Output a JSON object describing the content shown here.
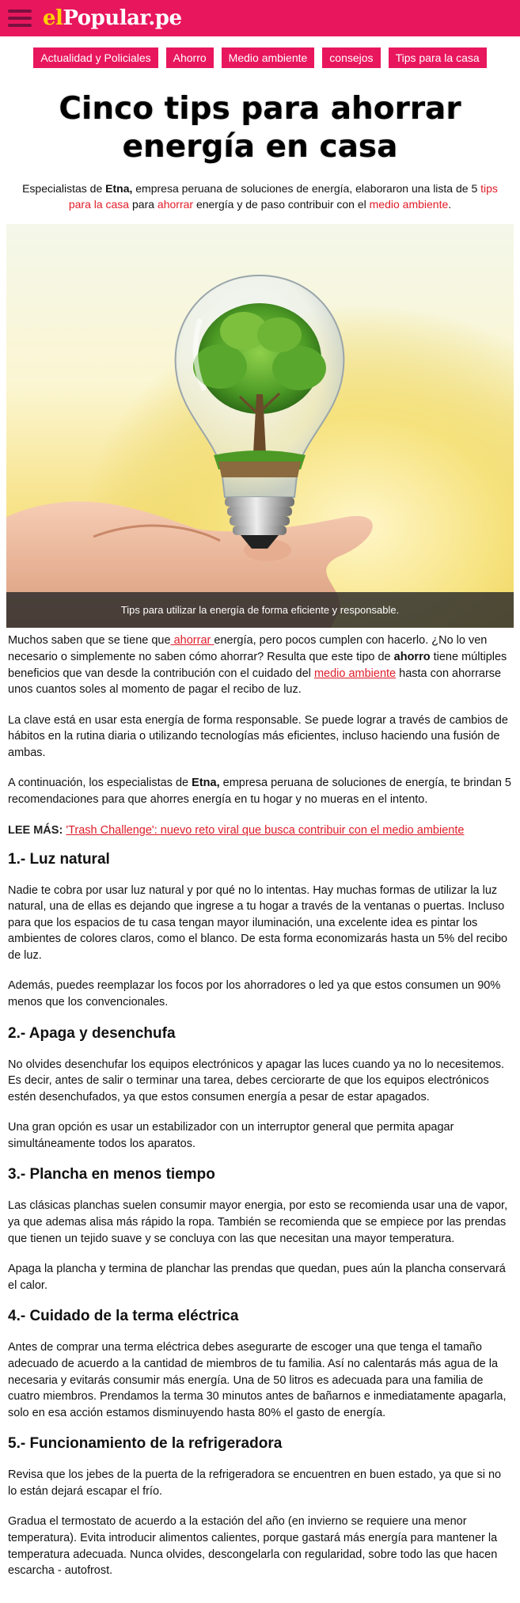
{
  "header": {
    "logo_prefix": "el",
    "logo_main": "Popular",
    "logo_suffix": ".pe",
    "brand_color": "#e8175d"
  },
  "tags": [
    "Actualidad y Policiales",
    "Ahorro",
    "Medio ambiente",
    "consejos",
    "Tips para la casa"
  ],
  "article": {
    "title": "Cinco tips para ahorrar energía en casa",
    "lead": {
      "t1": "Especialistas de ",
      "b1": "Etna,",
      "t2": " empresa peruana de soluciones de energía, elaboraron una lista de 5 ",
      "l1": "tips para la casa",
      "t3": " para ",
      "l2": "ahorrar",
      "t4": " energía y de paso contribuir con el ",
      "l3": "medio ambiente",
      "t5": "."
    },
    "image_caption": "Tips para utilizar la energía de forma eficiente y responsable.",
    "p1": {
      "t1": "Muchos saben que se tiene que",
      "l1": " ahorrar ",
      "t2": "energía, pero pocos cumplen con hacerlo. ¿No lo ven necesario o simplemente no saben cómo ahorrar? Resulta que este tipo de ",
      "b1": "ahorro",
      "t3": " tiene múltiples beneficios que van desde la contribución con el cuidado del ",
      "l2": "medio ambiente",
      "t4": " hasta con ahorrarse unos cuantos soles al momento de pagar el recibo de luz."
    },
    "p2": "La clave está en usar esta energía de forma responsable. Se puede lograr a través de cambios de hábitos en la rutina diaria o utilizando tecnologías más eficientes, incluso haciendo una fusión de ambas.",
    "p3": {
      "t1": "A continuación, los especialistas de ",
      "b1": "Etna,",
      "t2": " empresa peruana de soluciones de energía, te brindan 5 recomendaciones para que ahorres energía en tu hogar  y no mueras en el intento."
    },
    "lee_mas": {
      "label": "LEE MÁS:",
      "link": "'Trash Challenge': nuevo reto viral que busca contribuir con el medio ambiente"
    },
    "sections": [
      {
        "heading": "1.- Luz natural",
        "paras": [
          "Nadie te cobra por usar luz natural y por qué no lo intentas. Hay muchas formas de utilizar la luz natural, una de ellas es dejando que ingrese a tu hogar a través de la ventanas o puertas. Incluso para que los espacios de tu casa tengan mayor iluminación, una excelente idea es pintar los ambientes de colores claros, como el blanco. De esta forma economizarás hasta un 5% del recibo de luz.",
          "Además, puedes reemplazar los focos por los ahorradores o led ya que estos consumen un 90% menos que los convencionales."
        ]
      },
      {
        "heading": "2.- Apaga y desenchufa",
        "paras": [
          "No olvides desenchufar los equipos electrónicos y apagar las luces cuando ya no lo necesitemos. Es decir, antes de salir o terminar una tarea, debes cerciorarte de que los equipos electrónicos estén desenchufados, ya que  estos consumen energía a pesar de estar apagados.",
          "Una gran opción es usar un estabilizador con un interruptor general que permita apagar simultáneamente todos los aparatos."
        ]
      },
      {
        "heading": "3.- Plancha en menos tiempo",
        "paras": [
          "Las clásicas planchas suelen consumir mayor energia, por esto se  recomienda usar una de vapor, ya que ademas alisa más rápido la ropa. También se recomienda que se empiece por las prendas que tienen un tejido suave y se concluya con las que necesitan una mayor temperatura.",
          "Apaga la plancha y termina de  planchar las prendas que quedan, pues aún la plancha conservará el calor."
        ]
      },
      {
        "heading": "4.- Cuidado de la terma eléctrica",
        "paras": [
          "Antes de comprar una terma eléctrica debes asegurarte de escoger una que tenga el tamaño adecuado de acuerdo a la cantidad de miembros de tu familia. Así no calentarás más agua de la necesaria y evitarás consumir más energía. Una de 50 litros es adecuada para una familia de cuatro miembros. Prendamos la terma 30 minutos antes de bañarnos e inmediatamente apagarla, solo en esa acción estamos  disminuyendo hasta 80% el gasto de energía."
        ]
      },
      {
        "heading": "5.- Funcionamiento de la refrigeradora",
        "paras": [
          "Revisa que los jebes de la puerta de la refrigeradora se encuentren en buen estado, ya que si no lo están dejará escapar el frío.",
          "Gradua el  termostato de acuerdo a la estación del año (en invierno se requiere una menor temperatura). Evita introducir alimentos calientes, porque gastará más energía para mantener la temperatura adecuada. Nunca olvides, descongelarla con regularidad, sobre todo las que hacen escarcha - autofrost."
        ]
      }
    ]
  }
}
